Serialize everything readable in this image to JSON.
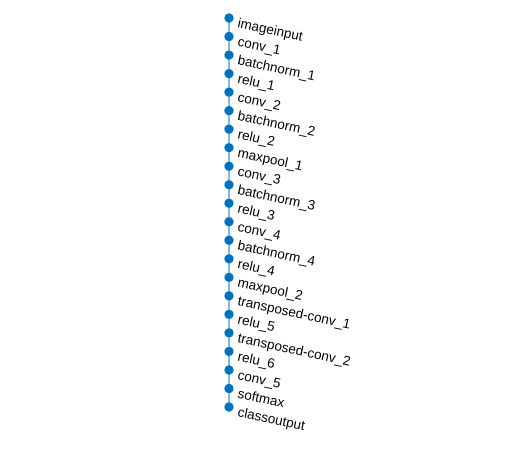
{
  "graph": {
    "nodes": [
      "imageinput",
      "conv_1",
      "batchnorm_1",
      "relu_1",
      "conv_2",
      "batchnorm_2",
      "relu_2",
      "maxpool_1",
      "conv_3",
      "batchnorm_3",
      "relu_3",
      "conv_4",
      "batchnorm_4",
      "relu_4",
      "maxpool_2",
      "transposed-conv_1",
      "relu_5",
      "transposed-conv_2",
      "relu_6",
      "conv_5",
      "softmax",
      "classoutput"
    ],
    "node_color": "#0072BD",
    "edge_color": "#0072BD",
    "label_color": "#000000"
  }
}
